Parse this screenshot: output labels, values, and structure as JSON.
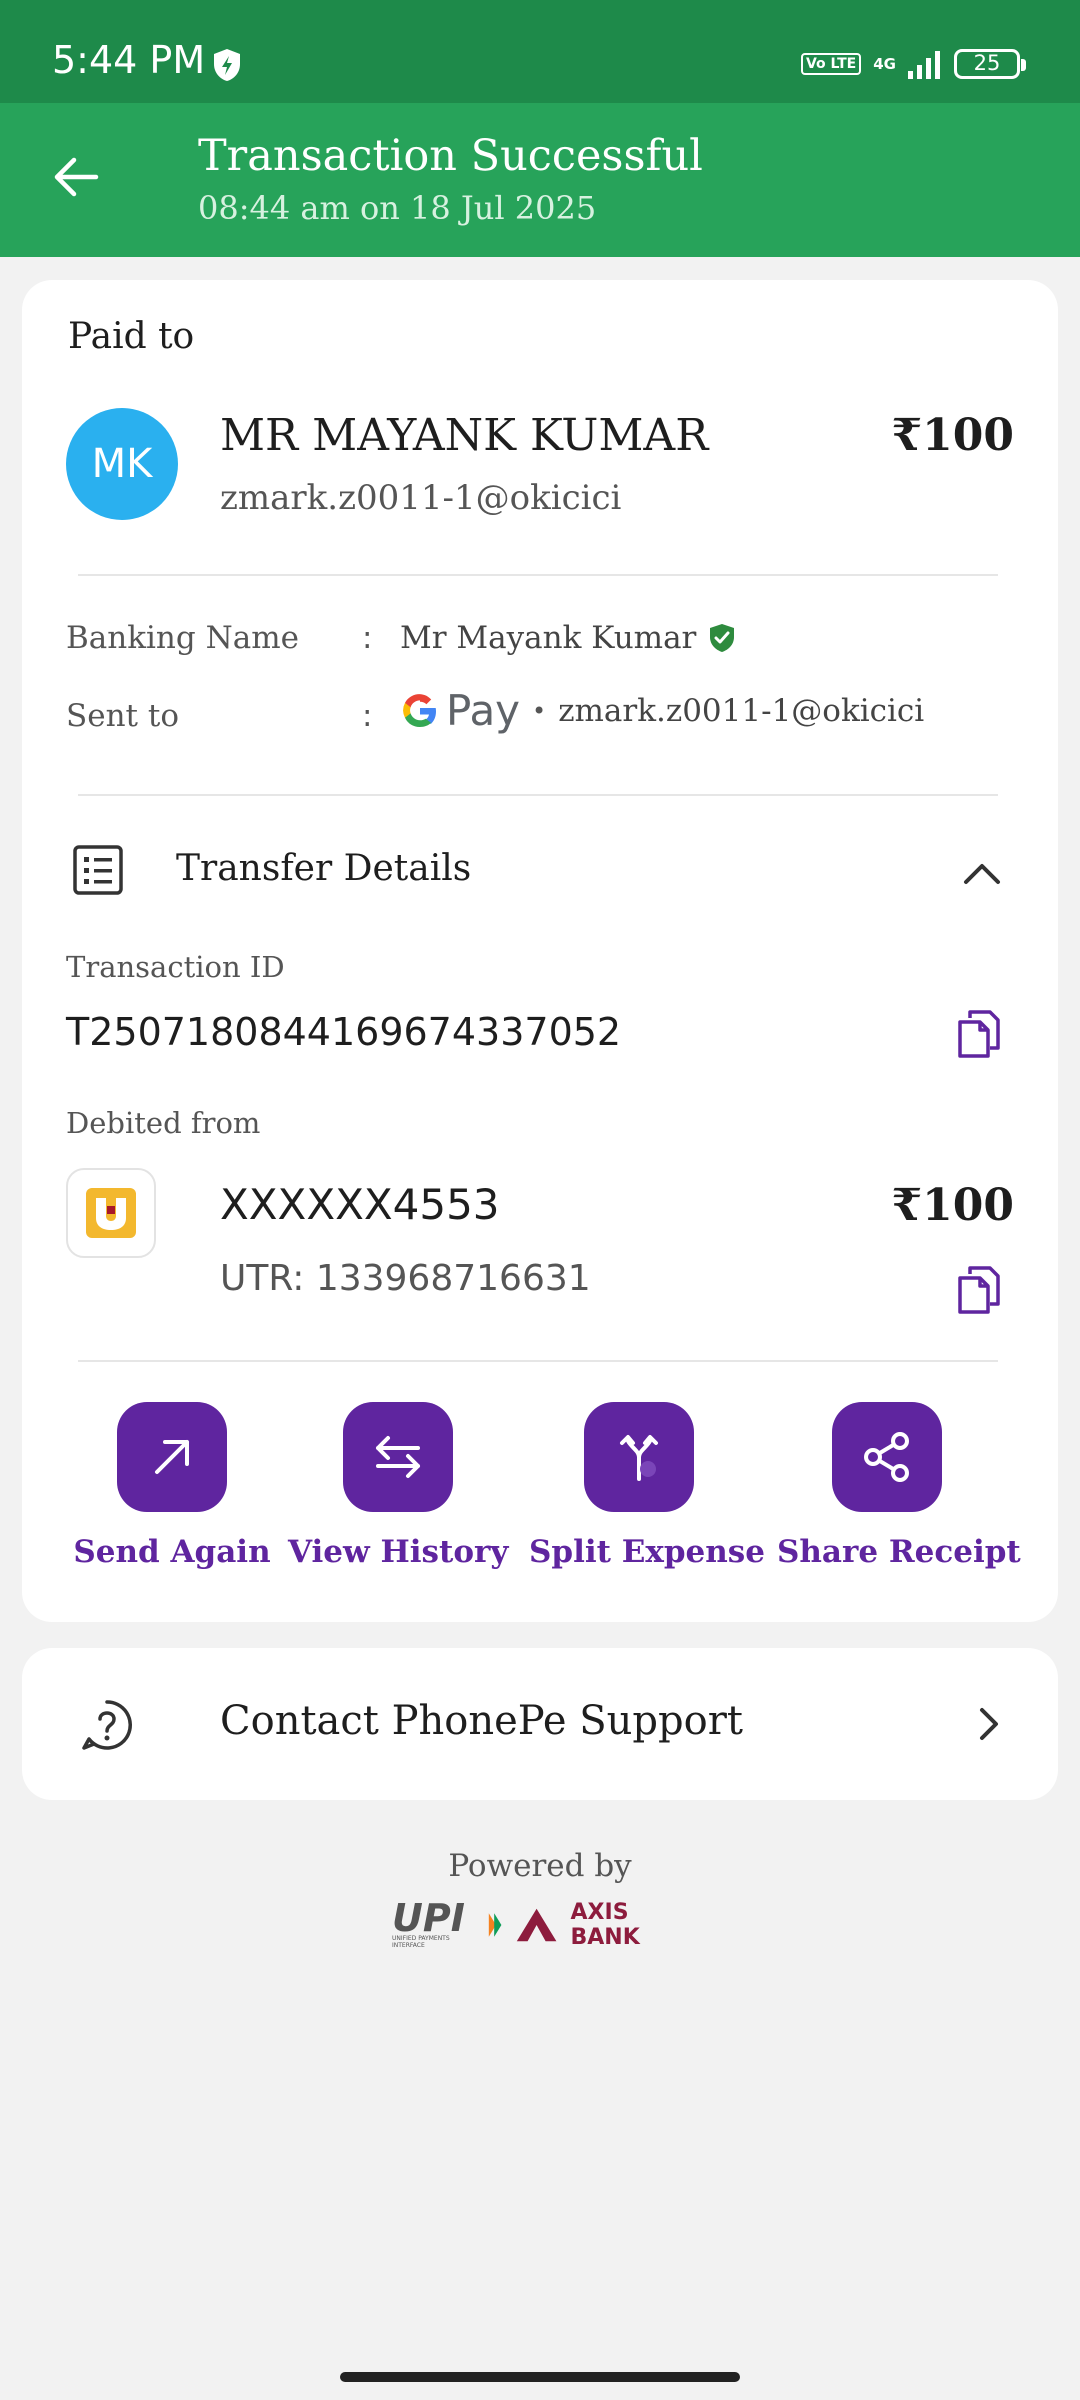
{
  "status_bar": {
    "time": "5:44 PM",
    "network_badge": "Vo LTE",
    "network_type": "4G",
    "battery": "25"
  },
  "header": {
    "title": "Transaction Successful",
    "subtitle": "08:44 am on 18 Jul 2025"
  },
  "payment": {
    "paid_to_label": "Paid to",
    "avatar_initials": "MK",
    "payee_name": "MR MAYANK  KUMAR",
    "payee_upi": "zmark.z0011-1@okicici",
    "amount": "₹100",
    "banking_name_label": "Banking Name",
    "banking_name_value": "Mr Mayank  Kumar",
    "sent_to_label": "Sent to",
    "sent_to_app": "Pay",
    "sent_to_upi": "zmark.z0011-1@okicici",
    "colon": ":",
    "bullet": "•"
  },
  "transfer": {
    "title": "Transfer Details",
    "transaction_id_label": "Transaction ID",
    "transaction_id": "T2507180844169674337052",
    "debited_from_label": "Debited from",
    "account": "XXXXXX4553",
    "amount": "₹100",
    "utr": "UTR: 133968716631"
  },
  "actions": [
    {
      "label": "Send Again",
      "icon": "arrow-up-right-icon"
    },
    {
      "label": "View History",
      "icon": "swap-arrows-icon"
    },
    {
      "label": "Split Expense",
      "icon": "split-icon"
    },
    {
      "label": "Share Receipt",
      "icon": "share-icon"
    }
  ],
  "support": {
    "label": "Contact PhonePe Support"
  },
  "footer": {
    "powered_by": "Powered by",
    "upi_logo": "UPI",
    "upi_tagline": "UNIFIED PAYMENTS INTERFACE",
    "bank_logo": "AXIS BANK"
  },
  "colors": {
    "status_bar": "#1e8a4a",
    "header": "#27a35a",
    "accent": "#5f259f",
    "avatar": "#2ab0ef",
    "background": "#f2f2f2"
  }
}
